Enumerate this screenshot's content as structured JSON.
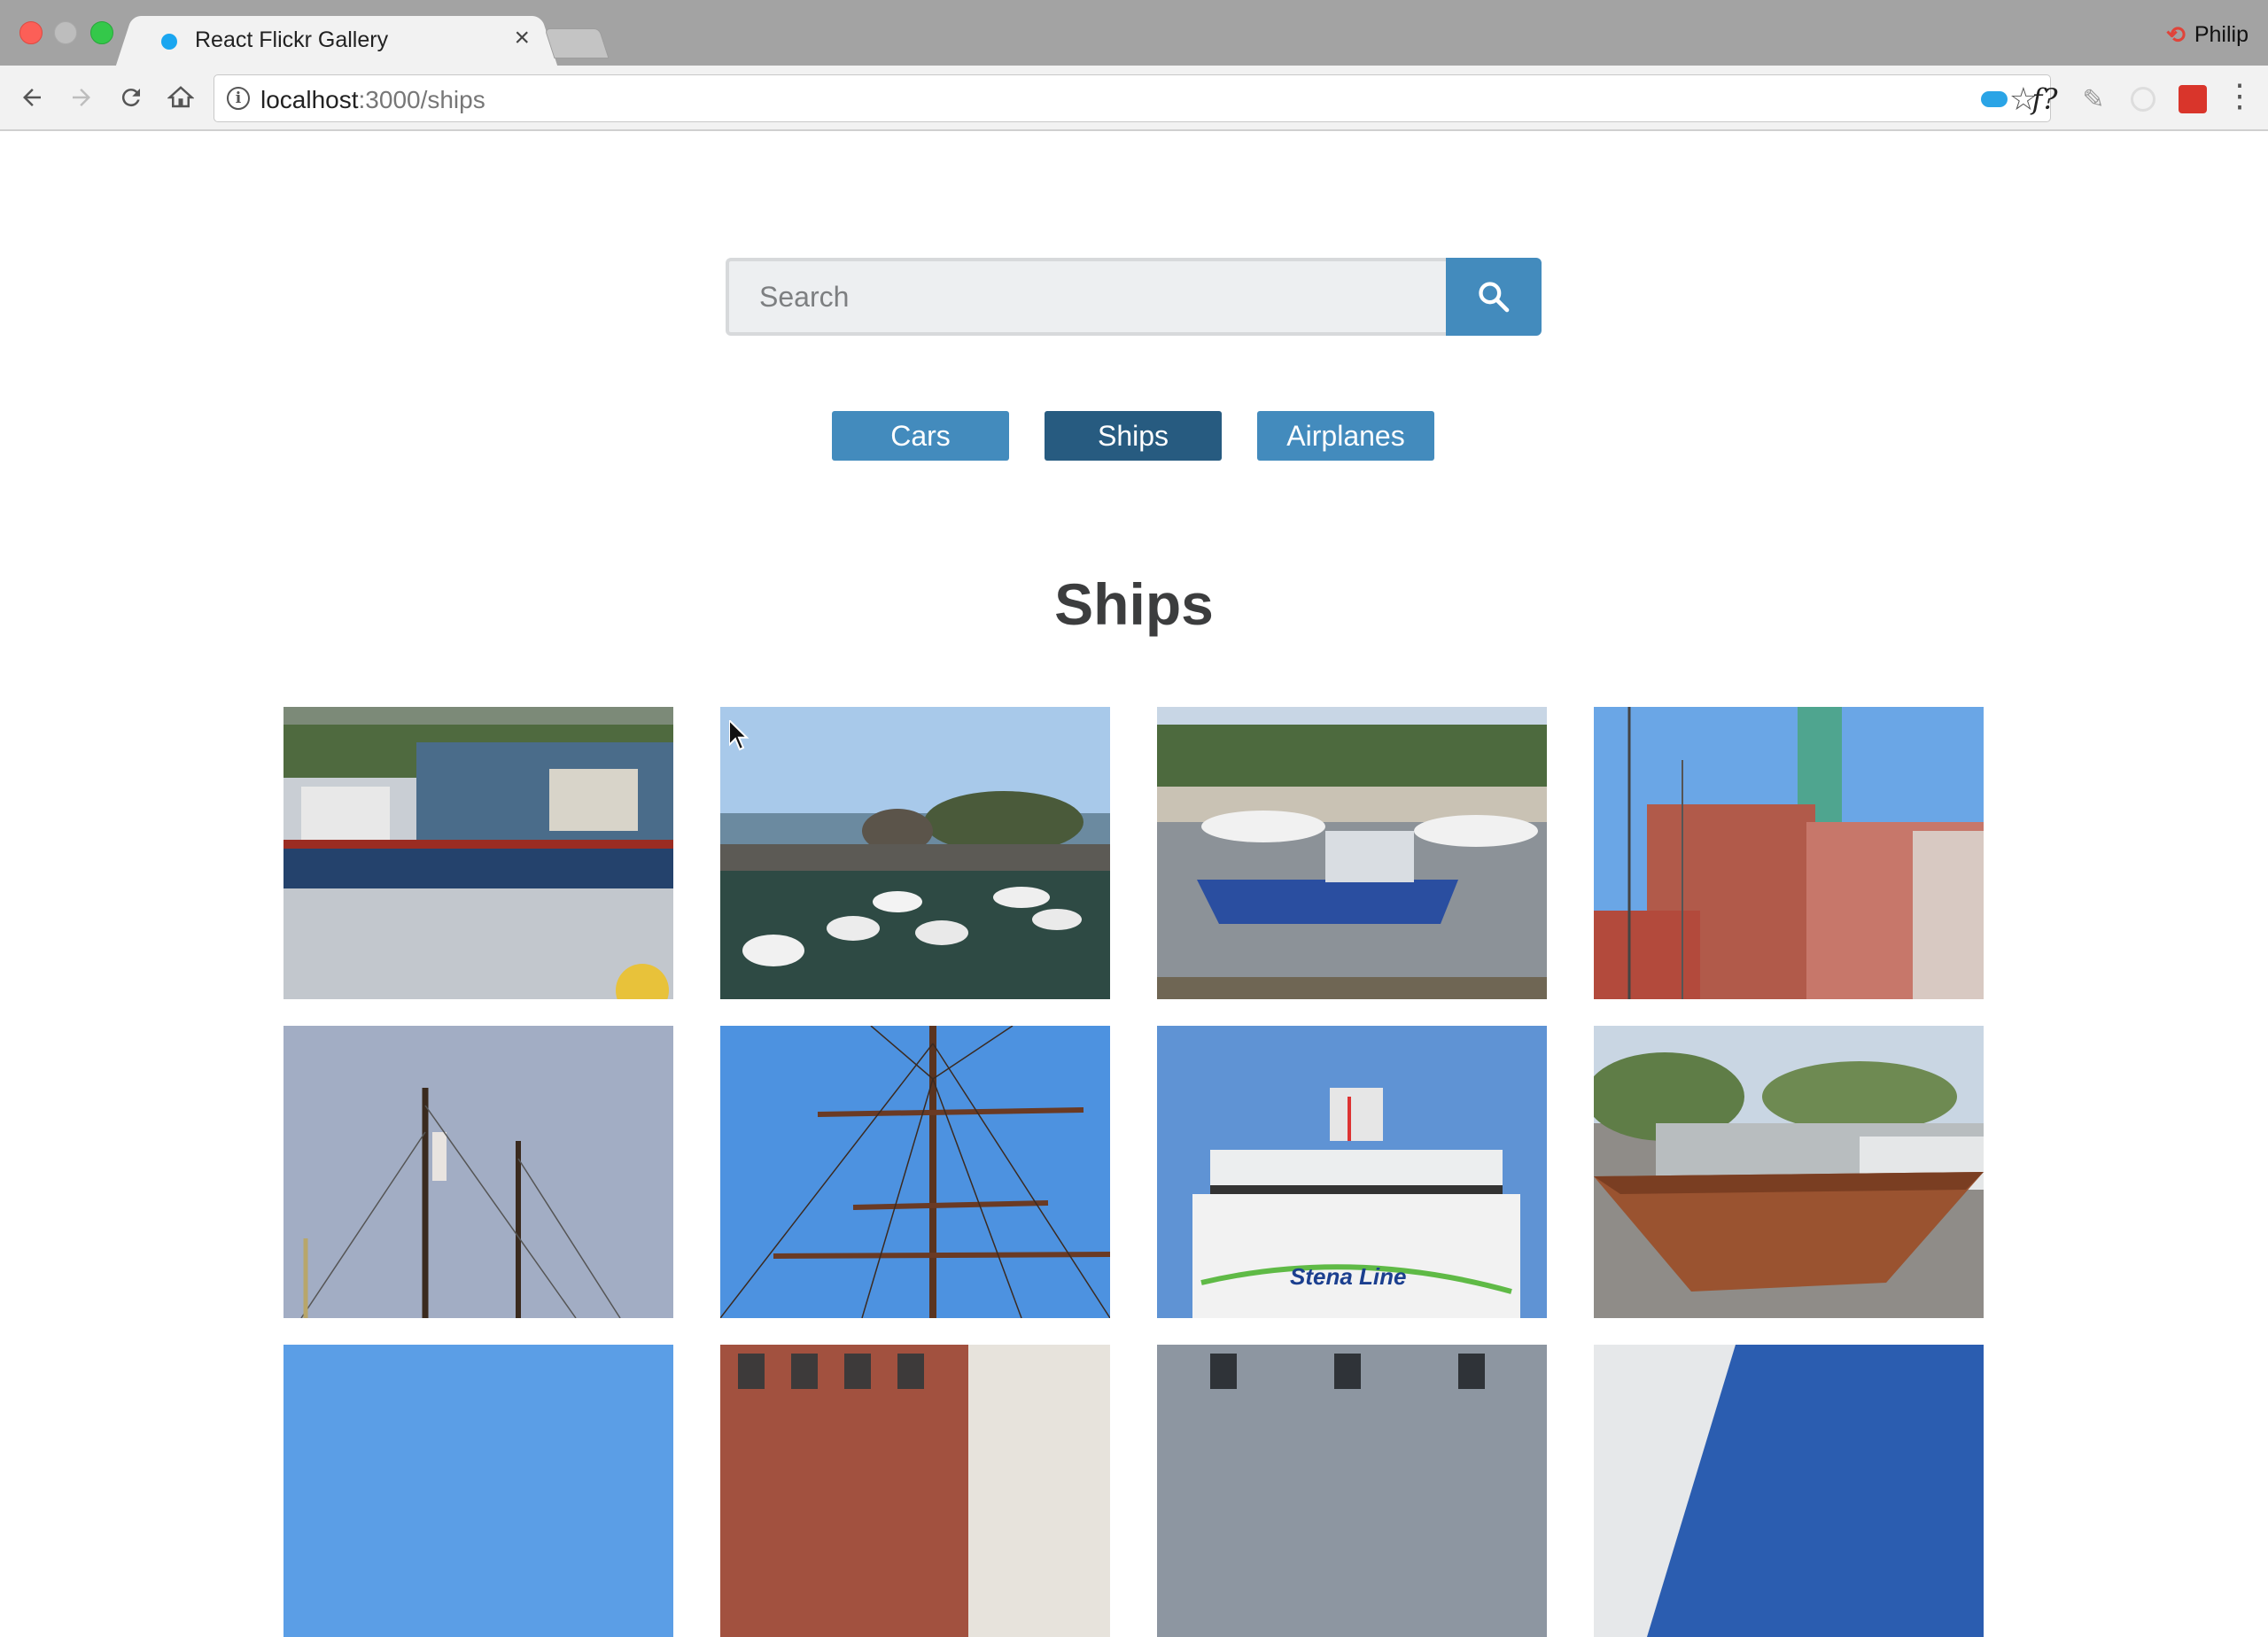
{
  "browser": {
    "tab_title": "React Flickr Gallery",
    "tab_close": "×",
    "profile_name": "Philip",
    "url_host": "localhost",
    "url_rest": ":3000/ships",
    "ext_f": "f?"
  },
  "search": {
    "placeholder": "Search"
  },
  "nav": {
    "links": [
      {
        "label": "Cars",
        "active": false
      },
      {
        "label": "Ships",
        "active": true
      },
      {
        "label": "Airplanes",
        "active": false
      }
    ]
  },
  "gallery": {
    "title": "Ships",
    "photos": [
      {
        "name": "photo-cargo-ship"
      },
      {
        "name": "photo-harbor-boats"
      },
      {
        "name": "photo-blue-fishing-boat"
      },
      {
        "name": "photo-brick-buildings-masts"
      },
      {
        "name": "photo-sailboat-masts"
      },
      {
        "name": "photo-tall-ship-rigging"
      },
      {
        "name": "photo-stena-line-ferry"
      },
      {
        "name": "photo-rust-sculpture"
      },
      {
        "name": "photo-sky"
      },
      {
        "name": "photo-brick-facade"
      },
      {
        "name": "photo-stone-building"
      },
      {
        "name": "photo-sail-blue"
      }
    ]
  },
  "colors": {
    "primary": "#438bbd",
    "active": "#275b80",
    "title": "#3c3d3e"
  }
}
